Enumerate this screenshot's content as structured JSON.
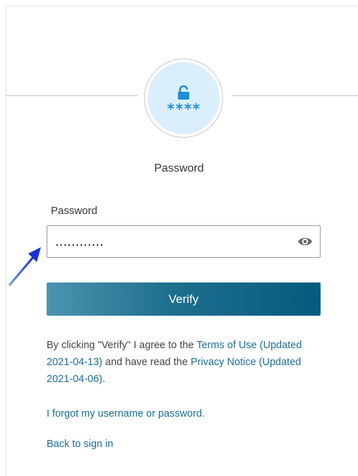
{
  "auth": {
    "icon_name": "unlocked-padlock-icon",
    "icon_stars": "****",
    "heading": "Password"
  },
  "form": {
    "password_label": "Password",
    "password_value": "............",
    "show_password_icon": "eye-icon",
    "verify_label": "Verify"
  },
  "legal": {
    "prefix": "By clicking \"Verify\" I agree to the ",
    "terms_link": "Terms of Use",
    "terms_updated": "(Updated 2021-04-13)",
    "middle": " and have read the ",
    "privacy_link": "Privacy Notice",
    "privacy_updated": " (Updated 2021-04-06)",
    "suffix": "."
  },
  "links": {
    "forgot": "I forgot my username or password.",
    "back": "Back to sign in"
  },
  "colors": {
    "accent": "#1b6d97",
    "icon_bg": "#dbeefb",
    "icon_fg": "#1f8fd6",
    "button_start": "#4a94b0",
    "button_end": "#055b7d",
    "annotation_arrow": "#1a2fd0"
  }
}
